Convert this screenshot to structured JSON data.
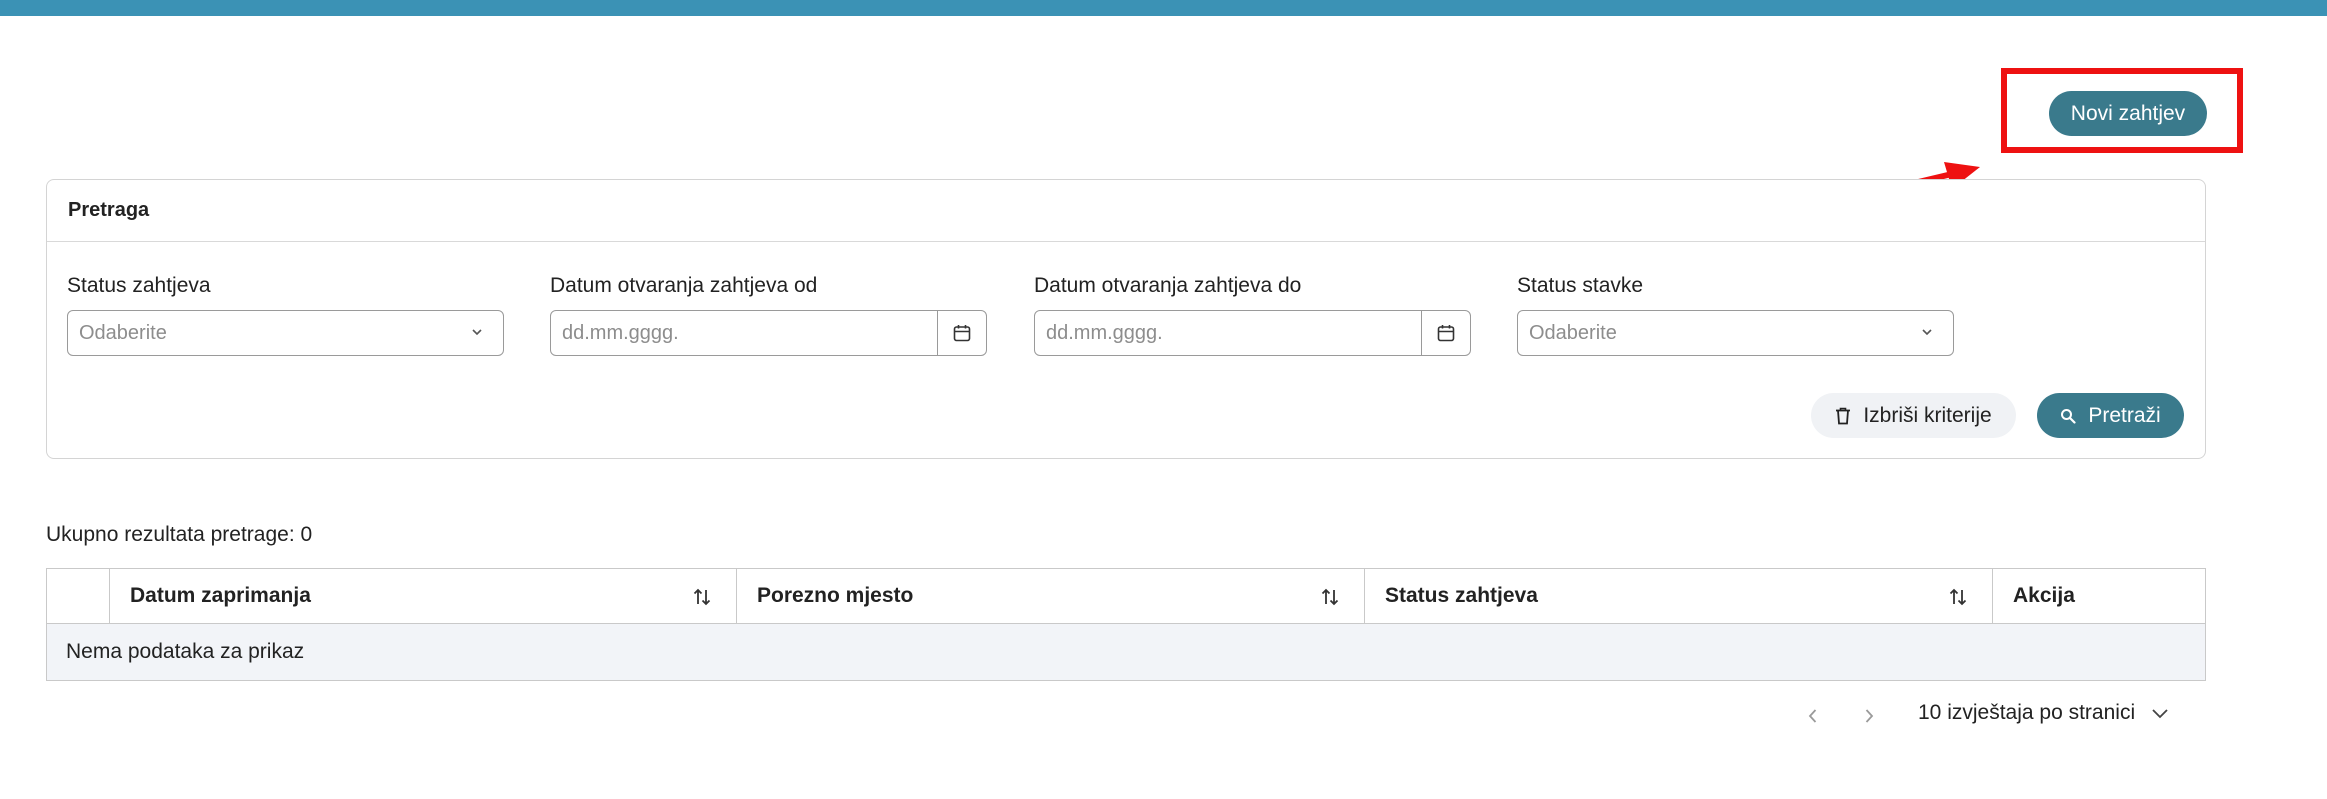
{
  "header": {
    "new_request_label": "Novi zahtjev"
  },
  "search_panel": {
    "title": "Pretraga",
    "fields": {
      "status_request": {
        "label": "Status zahtjeva",
        "placeholder": "Odaberite"
      },
      "date_from": {
        "label": "Datum otvaranja zahtjeva od",
        "placeholder": "dd.mm.gggg."
      },
      "date_to": {
        "label": "Datum otvaranja zahtjeva do",
        "placeholder": "dd.mm.gggg."
      },
      "status_item": {
        "label": "Status stavke",
        "placeholder": "Odaberite"
      }
    },
    "clear_label": "Izbriši kriterije",
    "search_label": "Pretraži"
  },
  "results": {
    "count_text": "Ukupno rezultata pretrage: 0",
    "columns": [
      "Datum zaprimanja",
      "Porezno mjesto",
      "Status zahtjeva",
      "Akcija"
    ],
    "empty_text": "Nema podataka za prikaz"
  },
  "pagination": {
    "page_size_label": "10 izvještaja po stranici"
  },
  "colors": {
    "top_bar": "#3b92b5",
    "primary_button": "#3a7a8c",
    "annotation_red": "#ee1111"
  },
  "icons": {
    "chevron": "chevron-down-icon",
    "calendar": "calendar-icon",
    "trash": "trash-icon",
    "search": "search-icon",
    "sort": "sort-icon"
  }
}
